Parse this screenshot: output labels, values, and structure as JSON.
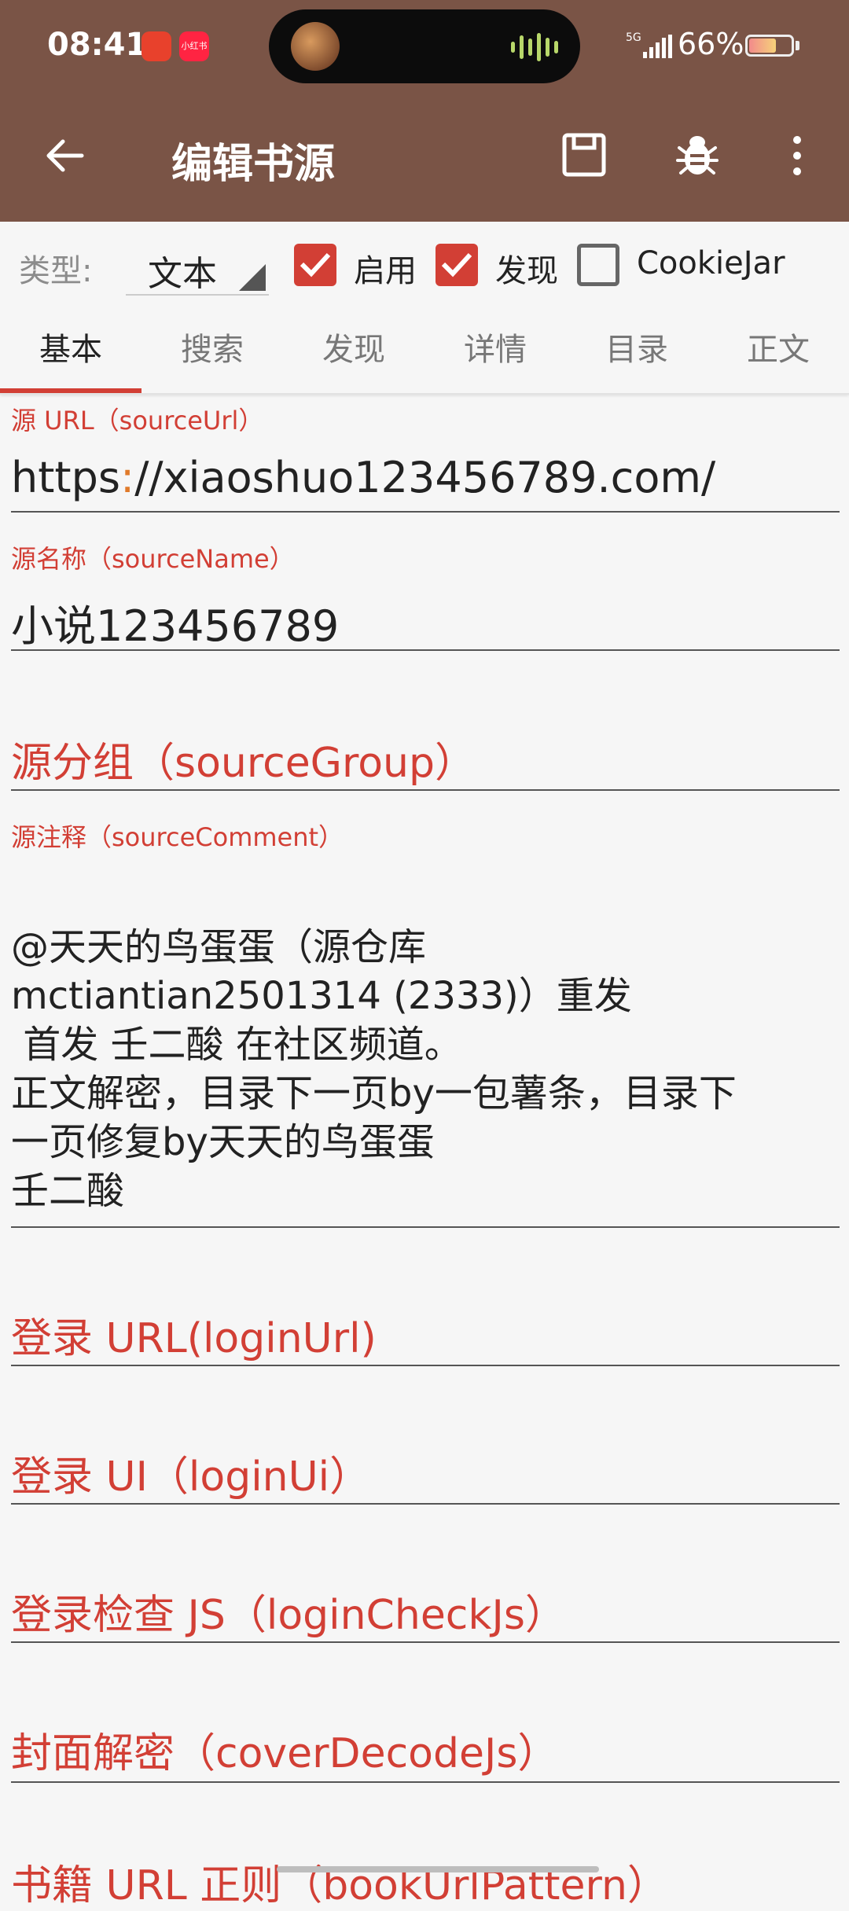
{
  "status_bar": {
    "time": "08:41",
    "notif1": "",
    "notif2": "小红书",
    "network": "5G",
    "battery": "66%",
    "battery_level": 0.66
  },
  "app_bar": {
    "title": "编辑书源",
    "back_icon": "arrow-left-icon",
    "save_icon": "save-icon",
    "debug_icon": "bug-icon",
    "more_icon": "more-vert-icon"
  },
  "options": {
    "type_label": "类型:",
    "type_value": "文本",
    "enable_label": "启用",
    "enable_checked": true,
    "discover_label": "发现",
    "discover_checked": true,
    "cookiejar_label": "CookieJar",
    "cookiejar_checked": false
  },
  "tabs": [
    {
      "label": "基本",
      "active": true
    },
    {
      "label": "搜索",
      "active": false
    },
    {
      "label": "发现",
      "active": false
    },
    {
      "label": "详情",
      "active": false
    },
    {
      "label": "目录",
      "active": false
    },
    {
      "label": "正文",
      "active": false
    }
  ],
  "fields": {
    "source_url_label": "源 URL（sourceUrl）",
    "source_url_prefix": "https",
    "source_url_colon": ":",
    "source_url_rest": "//xiaoshuo123456789.com/",
    "source_name_label": "源名称（sourceName）",
    "source_name_value": "小说123456789",
    "source_group_hint": "源分组（sourceGroup）",
    "source_comment_label": "源注释（sourceComment）",
    "source_comment_value": "@天天的鸟蛋蛋（源仓库\nmctiantian2501314 (2333)）重发\n 首发 壬二酸 在社区频道。\n正文解密，目录下一页by一包薯条，目录下\n一页修复by天天的鸟蛋蛋\n壬二酸",
    "login_url_hint": "登录 URL(loginUrl)",
    "login_ui_hint": "登录 UI（loginUi）",
    "login_check_js_hint": "登录检查 JS（loginCheckJs）",
    "cover_decode_hint": "封面解密（coverDecodeJs）",
    "bookurl_pattern_hint": "书籍 URL 正则（bookUrlPattern）"
  },
  "colors": {
    "app_bar": "#7a5446",
    "accent": "#d23f35",
    "background": "#f6f6f6"
  }
}
